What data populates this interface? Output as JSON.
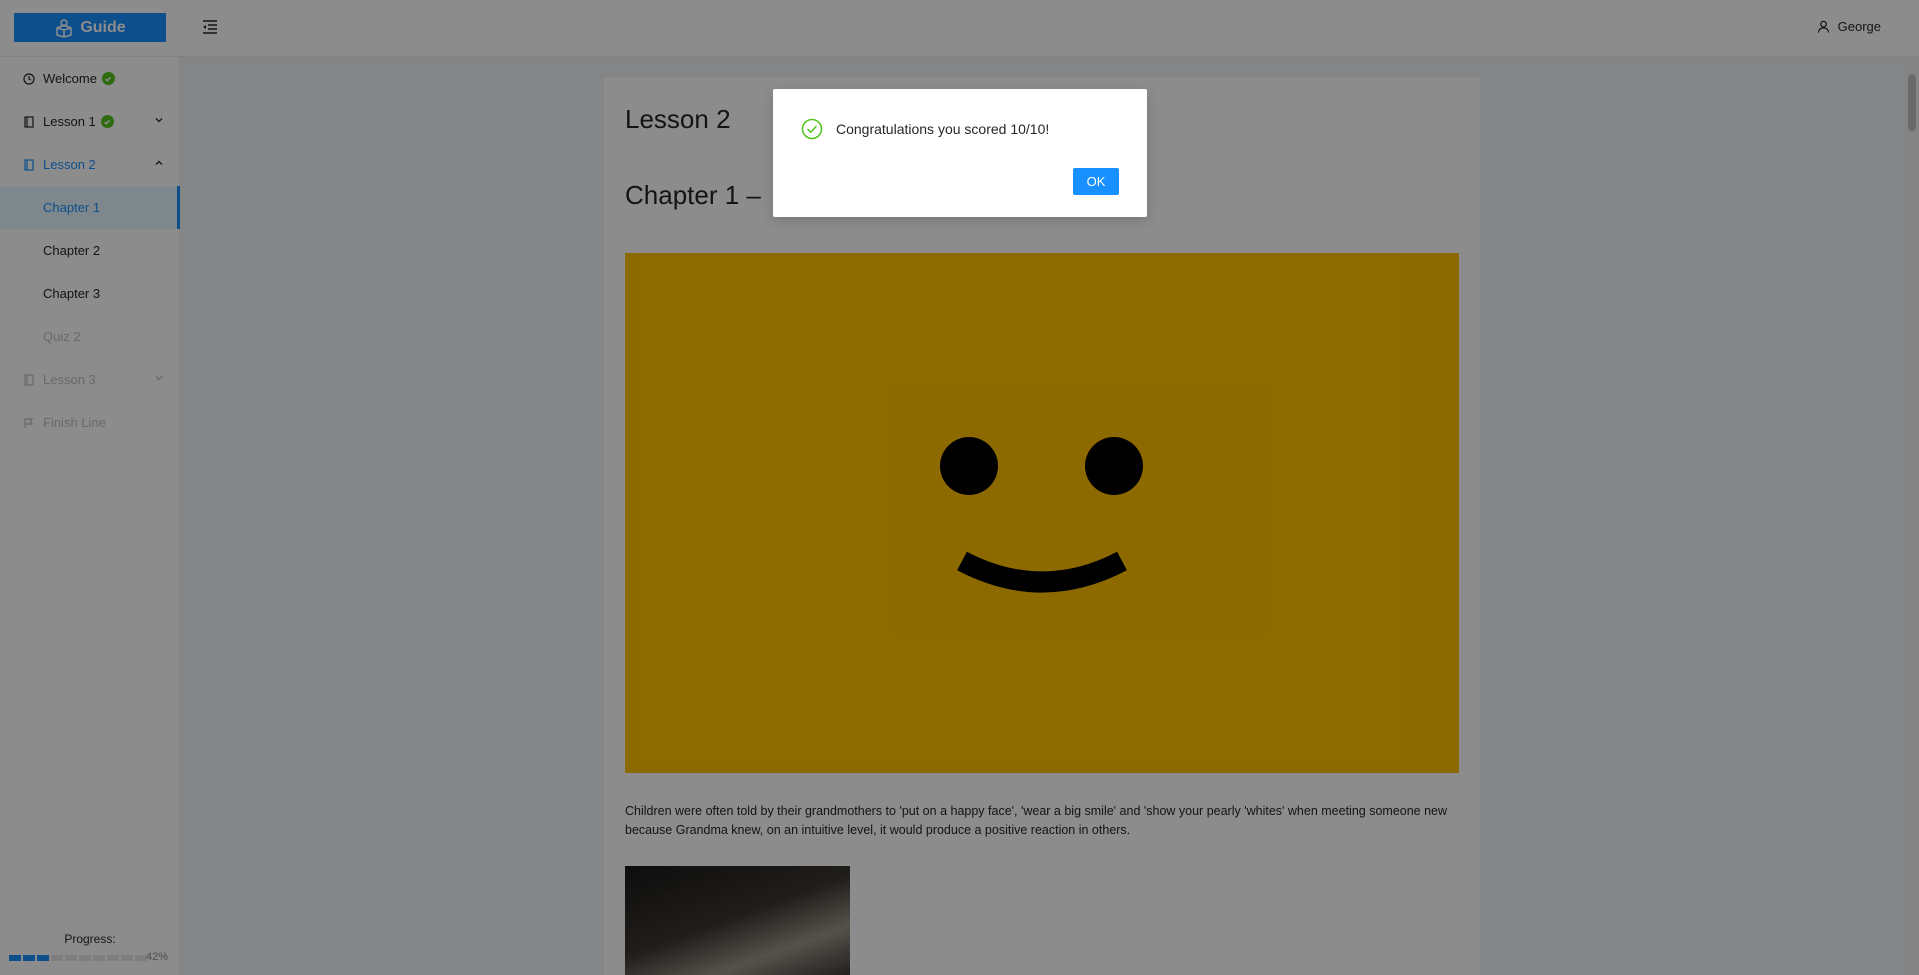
{
  "header": {
    "logo_text": "Guide",
    "user_name": "George"
  },
  "sidebar": {
    "items": [
      {
        "label": "Welcome",
        "icon": "clock-icon",
        "completed": true
      },
      {
        "label": "Lesson 1",
        "icon": "book-icon",
        "completed": true,
        "expandable": true
      },
      {
        "label": "Lesson 2",
        "icon": "book-icon",
        "expandable": true,
        "expanded": true
      },
      {
        "label": "Chapter 1",
        "selected": true
      },
      {
        "label": "Chapter 2"
      },
      {
        "label": "Chapter 3"
      },
      {
        "label": "Quiz 2",
        "disabled": true
      },
      {
        "label": "Lesson 3",
        "icon": "book-icon",
        "disabled": true,
        "expandable": true
      },
      {
        "label": "Finish Line",
        "icon": "flag-icon",
        "disabled": true
      }
    ],
    "progress_label": "Progress:",
    "progress_percent": "42%",
    "progress_value": 0.42
  },
  "content": {
    "lesson_title": "Lesson 2",
    "chapter_title": "Chapter 1 –",
    "paragraph": "Children were often told by their grandmothers to 'put on a happy face', 'wear a big smile' and 'show your pearly 'whites' when meeting someone new because Grandma knew, on an intuitive level, it would produce a positive reaction in others."
  },
  "modal": {
    "message": "Congratulations you scored 10/10!",
    "ok_label": "OK"
  },
  "colors": {
    "primary": "#1890ff",
    "success": "#52c41a",
    "hero_yellow": "#ffc200"
  }
}
